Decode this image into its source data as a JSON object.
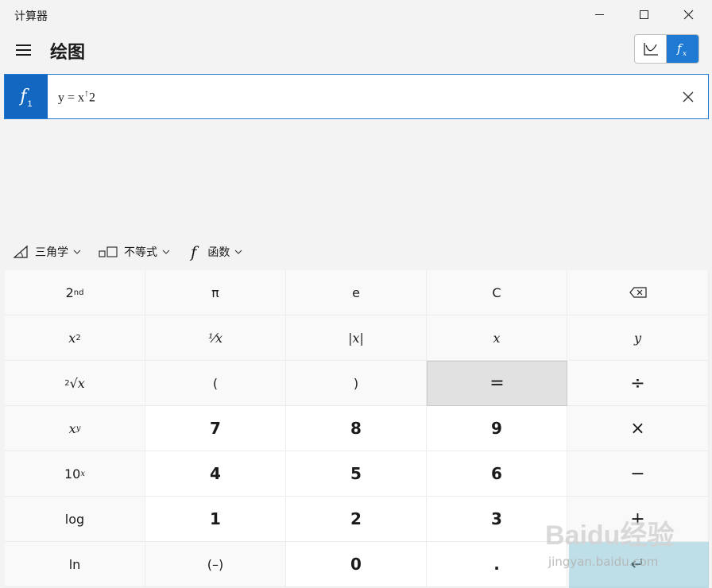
{
  "window": {
    "title": "计算器"
  },
  "header": {
    "title": "绘图"
  },
  "function_row": {
    "badge_letter": "f",
    "badge_index": "1",
    "expression_prefix": "y = x",
    "expression_caret": "↑",
    "expression_suffix": "2"
  },
  "menubar": {
    "items": [
      {
        "label": "三角学",
        "icon": "triangle-ruler-icon"
      },
      {
        "label": "不等式",
        "icon": "inequality-icon"
      },
      {
        "label": "函数",
        "icon": "function-f-icon"
      }
    ]
  },
  "keypad": {
    "rows": [
      [
        "2nd",
        "π",
        "e",
        "C",
        "⌫"
      ],
      [
        "x²",
        "⅟x",
        "|x|",
        "x",
        "y"
      ],
      [
        "²√x",
        "(",
        ")",
        "=",
        "÷"
      ],
      [
        "xʸ",
        "7",
        "8",
        "9",
        "×"
      ],
      [
        "10ˣ",
        "4",
        "5",
        "6",
        "−"
      ],
      [
        "log",
        "1",
        "2",
        "3",
        "+"
      ],
      [
        "ln",
        "(–)",
        "0",
        ".",
        "↵"
      ]
    ]
  },
  "keys": {
    "r0": {
      "second": "2",
      "second_sup": "nd",
      "pi": "π",
      "e": "e",
      "clear": "C"
    },
    "r1": {
      "sq_base": "x",
      "sq_sup": "2",
      "recip": "⅟x",
      "abs": "|x|",
      "x": "x",
      "y": "y"
    },
    "r2": {
      "root_idx": "2",
      "root": "√x",
      "lparen": "(",
      "rparen": ")",
      "equals": "=",
      "divide": "÷"
    },
    "r3": {
      "pow_base": "x",
      "pow_sup": "y",
      "seven": "7",
      "eight": "8",
      "nine": "9",
      "multiply": "×"
    },
    "r4": {
      "ten_base": "10",
      "ten_sup": "x",
      "four": "4",
      "five": "5",
      "six": "6",
      "minus": "−"
    },
    "r5": {
      "log": "log",
      "one": "1",
      "two": "2",
      "three": "3",
      "plus": "+"
    },
    "r6": {
      "ln": "ln",
      "negate": "(–)",
      "zero": "0",
      "dot": ".",
      "enter": "↵"
    }
  },
  "watermark": {
    "main": "Baidu经验",
    "sub": "jingyan.baidu.com"
  }
}
